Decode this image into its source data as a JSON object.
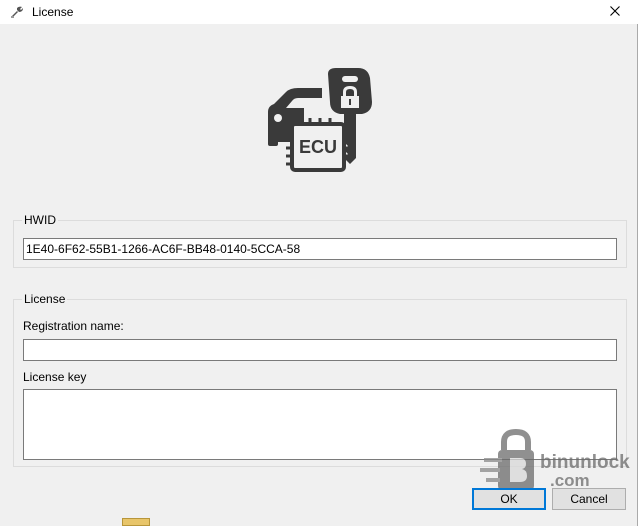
{
  "window": {
    "title": "License",
    "icon": "tool-icon",
    "close_glyph": "✕"
  },
  "logo": {
    "icon": "ecu-key-icon",
    "text": "ECU"
  },
  "hwid_group": {
    "legend": "HWID",
    "value": "1E40-6F62-55B1-1266-AC6F-BB48-0140-5CCA-58"
  },
  "license_group": {
    "legend": "License",
    "registration_label": "Registration name:",
    "registration_value": "",
    "key_label": "License key",
    "key_value": ""
  },
  "buttons": {
    "ok_label": "OK",
    "cancel_label": "Cancel"
  },
  "watermark": {
    "line1": "binunlock",
    "line2": ".com"
  },
  "colors": {
    "window_bg": "#f0f0f0",
    "accent": "#0078d7",
    "logo": "#3a3a3a"
  }
}
